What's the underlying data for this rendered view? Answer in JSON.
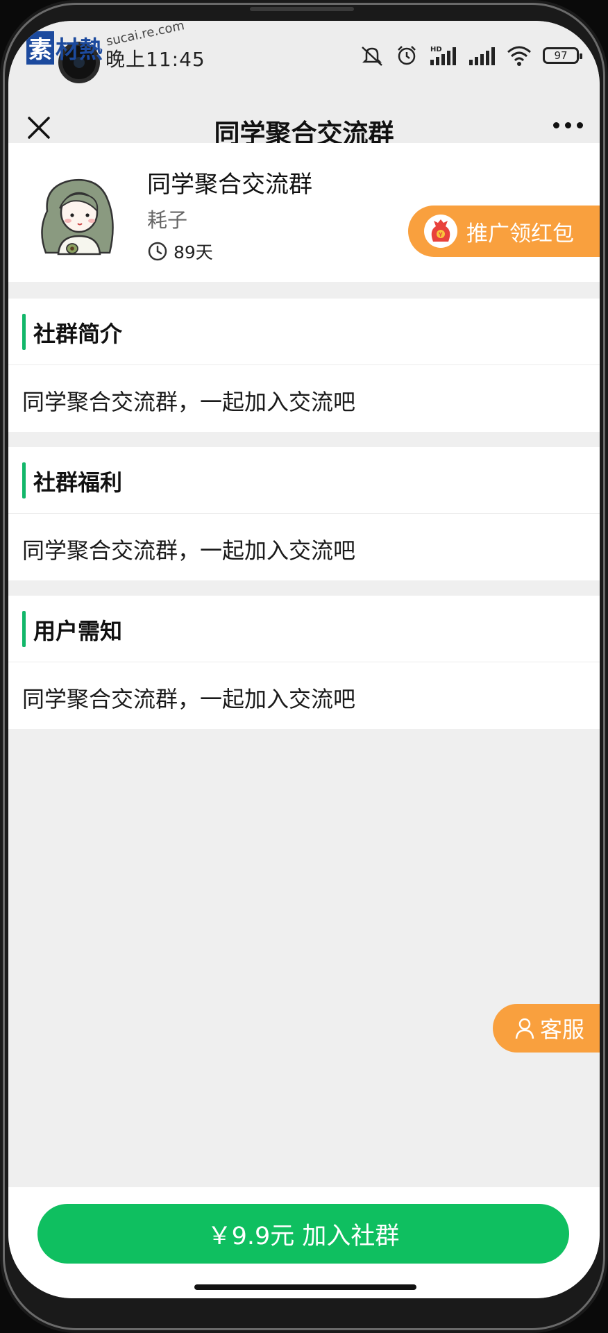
{
  "status_bar": {
    "time": "晚上11:45",
    "battery": "97",
    "watermark_badge": "素",
    "watermark_text": "材熱",
    "watermark_url": "sucai.re.com"
  },
  "nav": {
    "title": "同学聚合交流群"
  },
  "group": {
    "name": "同学聚合交流群",
    "owner": "耗子",
    "days": "89天",
    "promo_label": "推广领红包"
  },
  "sections": [
    {
      "title": "社群简介",
      "text": "同学聚合交流群，一起加入交流吧"
    },
    {
      "title": "社群福利",
      "text": "同学聚合交流群，一起加入交流吧"
    },
    {
      "title": "用户需知",
      "text": "同学聚合交流群，一起加入交流吧"
    }
  ],
  "service": {
    "label": "客服"
  },
  "bottom": {
    "join_label": "￥9.9元 加入社群"
  },
  "colors": {
    "accent_green": "#0fbf60",
    "section_bar": "#12b76a",
    "orange": "#f9a03e"
  },
  "icons": [
    "close-icon",
    "more-icon",
    "clock-icon",
    "red-packet-icon",
    "user-icon"
  ]
}
